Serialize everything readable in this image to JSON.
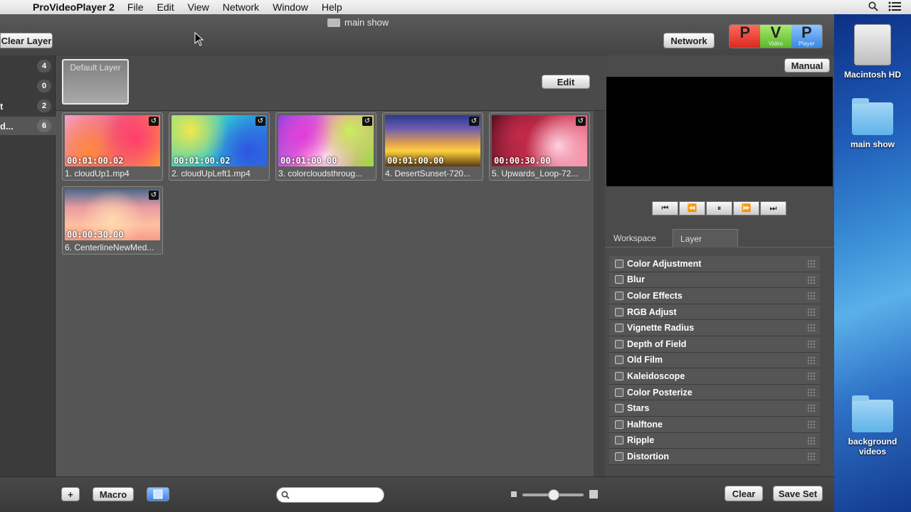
{
  "menubar": {
    "app_name": "ProVideoPlayer 2",
    "items": [
      "File",
      "Edit",
      "View",
      "Network",
      "Window",
      "Help"
    ]
  },
  "window": {
    "document_title": "main show",
    "clear_layer_label": "Clear Layer",
    "network_label": "Network",
    "pvp_badge": [
      {
        "letter": "P",
        "caption": "",
        "color": "#e8443a"
      },
      {
        "letter": "V",
        "caption": "Video",
        "color": "#7ed04b"
      },
      {
        "letter": "P",
        "caption": "Player",
        "color": "#4d9df0"
      }
    ]
  },
  "left_panel": {
    "rows": [
      {
        "label": "",
        "count": "4"
      },
      {
        "label": "",
        "count": "0"
      },
      {
        "label": "t",
        "count": "2"
      },
      {
        "label": "d...",
        "count": "6",
        "selected": true
      }
    ]
  },
  "layer_band": {
    "default_layer_label": "Default Layer",
    "edit_label": "Edit"
  },
  "cues": [
    {
      "time": "00:01:00.02",
      "name": "1. cloudUp1.mp4"
    },
    {
      "time": "00:01:00.02",
      "name": "2. cloudUpLeft1.mp4"
    },
    {
      "time": "00:01:00.00",
      "name": "3. colorcloudsthroug..."
    },
    {
      "time": "00:01:00.00",
      "name": "4. DesertSunset-720..."
    },
    {
      "time": "00:00:30.00",
      "name": "5. Upwards_Loop-72..."
    },
    {
      "time": "00:00:30.00",
      "name": "6. CenterlineNewMed..."
    }
  ],
  "right_panel": {
    "manual_label": "Manual",
    "transport": [
      "⏮",
      "⏪",
      "⏸",
      "⏩",
      "⏭"
    ],
    "tabs": [
      "Workspace",
      "Layer"
    ],
    "effects": [
      "Color Adjustment",
      "Blur",
      "Color Effects",
      "RGB Adjust",
      "Vignette Radius",
      "Depth of Field",
      "Old Film",
      "Kaleidoscope",
      "Color Posterize",
      "Stars",
      "Halftone",
      "Ripple",
      "Distortion"
    ]
  },
  "bottom_bar": {
    "add_label": "+",
    "macro_label": "Macro",
    "clear_label": "Clear",
    "save_set_label": "Save Set",
    "search_placeholder": ""
  },
  "desktop": {
    "icons": [
      "Macintosh HD",
      "main show",
      "background videos"
    ]
  }
}
